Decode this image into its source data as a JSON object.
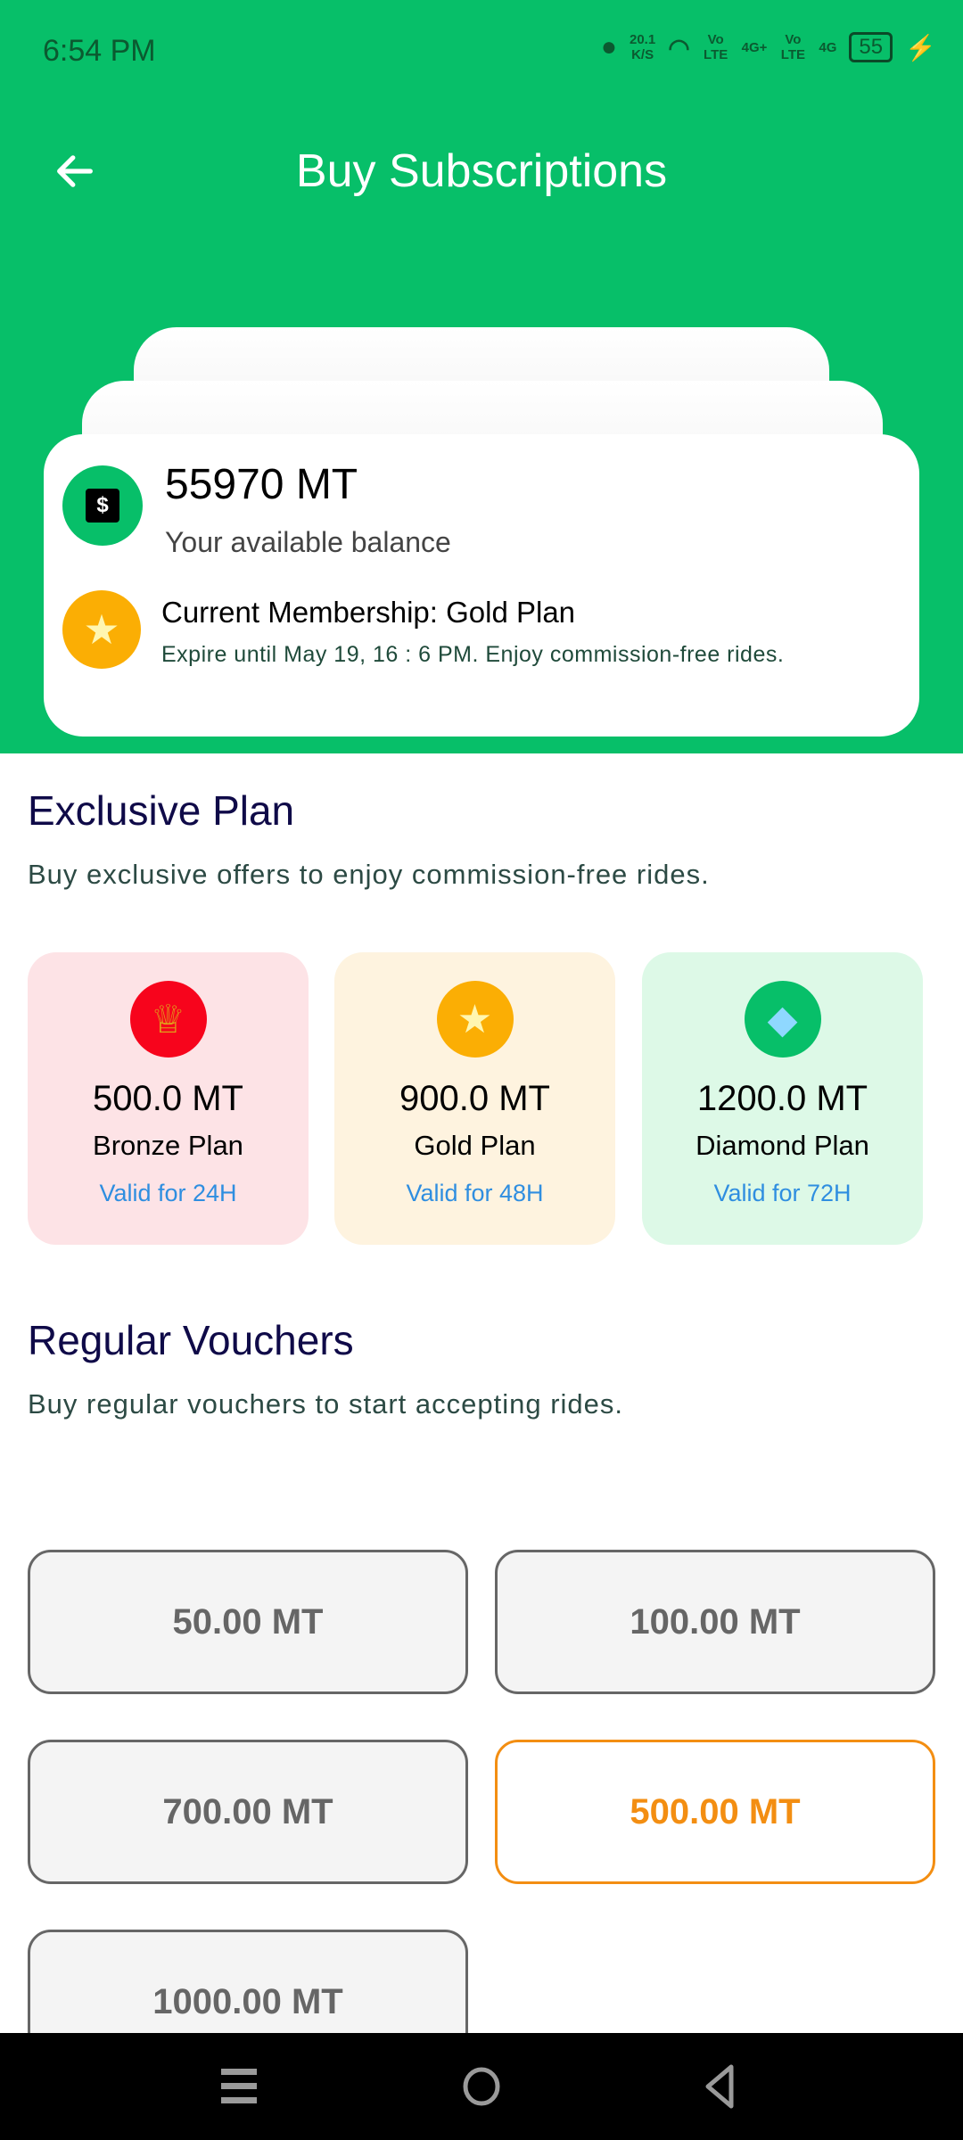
{
  "status_bar": {
    "time": "6:54 PM",
    "net_speed": "20.1",
    "net_unit": "K/S",
    "sim1": "4G+",
    "sim2": "4G",
    "volte": "Vo LTE",
    "battery": "55"
  },
  "header": {
    "title": "Buy Subscriptions"
  },
  "balance": {
    "amount": "55970 MT",
    "label": "Your available balance"
  },
  "membership": {
    "title": "Current Membership: Gold Plan",
    "detail": "Expire until May 19, 16 : 6 PM. Enjoy commission-free rides."
  },
  "exclusive": {
    "title": "Exclusive Plan",
    "subtitle": "Buy exclusive offers to enjoy commission-free rides.",
    "plans": [
      {
        "price": "500.0 MT",
        "name": "Bronze Plan",
        "valid": "Valid for 24H",
        "icon": "trophy-icon",
        "bg": "#fde3e6",
        "icon_bg": "#f7041c"
      },
      {
        "price": "900.0 MT",
        "name": "Gold Plan",
        "valid": "Valid for 48H",
        "icon": "star-icon",
        "bg": "#fef3df",
        "icon_bg": "#fbae04"
      },
      {
        "price": "1200.0 MT",
        "name": "Diamond Plan",
        "valid": "Valid for 72H",
        "icon": "diamond-icon",
        "bg": "#ddf9e7",
        "icon_bg": "#07bf69"
      }
    ]
  },
  "regular": {
    "title": "Regular Vouchers",
    "subtitle": "Buy regular vouchers to start accepting rides.",
    "vouchers": [
      "50.00 MT",
      "100.00 MT",
      "700.00 MT",
      "500.00 MT",
      "1000.00 MT"
    ],
    "selected": "500.00 MT"
  },
  "colors": {
    "primary": "#07bf69",
    "selected": "#f38e12"
  }
}
